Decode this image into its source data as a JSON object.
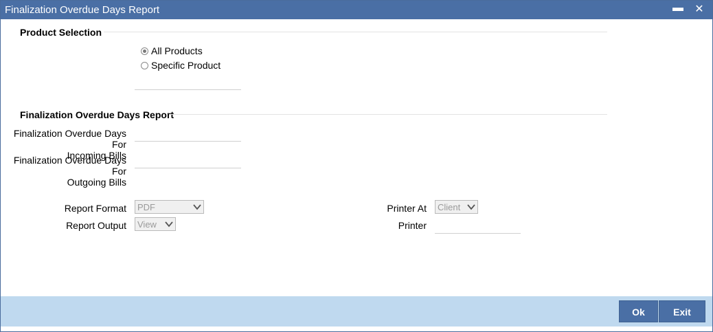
{
  "window": {
    "title": "Finalization Overdue Days Report",
    "minimize_glyph": "▬",
    "close_glyph": "✕"
  },
  "product_selection": {
    "heading": "Product Selection",
    "options": [
      {
        "label": "All Products",
        "checked": true
      },
      {
        "label": "Specific Product",
        "checked": false
      }
    ],
    "product_value": ""
  },
  "overdue_section": {
    "heading": "Finalization Overdue Days Report",
    "incoming_label_line1": "Finalization Overdue Days For",
    "incoming_label_line2": "Incoming Bills",
    "incoming_value": "",
    "outgoing_label_line1": "Finalization Overdue Days For",
    "outgoing_label_line2": "Outgoing Bills",
    "outgoing_value": ""
  },
  "report": {
    "format_label": "Report Format",
    "format_value": "PDF",
    "output_label": "Report Output",
    "output_value": "View",
    "printer_at_label": "Printer At",
    "printer_at_value": "Client",
    "printer_label": "Printer",
    "printer_value": ""
  },
  "footer": {
    "ok_label": "Ok",
    "exit_label": "Exit"
  },
  "colors": {
    "titlebar": "#4a6fa5",
    "footer": "#bfd9ef",
    "button": "#4a6fa5"
  }
}
